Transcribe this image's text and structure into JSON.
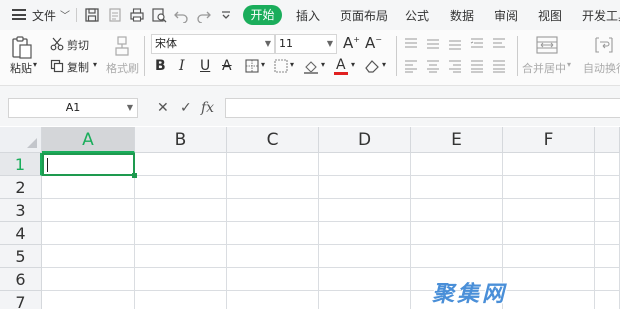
{
  "menubar": {
    "file_label": "文件",
    "tabs": [
      "开始",
      "插入",
      "页面布局",
      "公式",
      "数据",
      "审阅",
      "视图",
      "开发工具"
    ],
    "active_tab": "开始"
  },
  "ribbon": {
    "paste_label": "粘贴",
    "cut_label": "剪切",
    "copy_label": "复制",
    "format_painter_label": "格式刷",
    "font_name": "宋体",
    "font_size": "11",
    "merge_center_label": "合并居中",
    "wrap_text_label": "自动换行",
    "font_color": "#e02020",
    "accent": "#1aad5b"
  },
  "formula_bar": {
    "cell_ref": "A1",
    "cancel_symbol": "✕",
    "confirm_symbol": "✓",
    "fx_symbol": "fx",
    "value": ""
  },
  "grid": {
    "columns": [
      "A",
      "B",
      "C",
      "D",
      "E",
      "F"
    ],
    "rows": [
      "1",
      "2",
      "3",
      "4",
      "5",
      "6",
      "7"
    ],
    "active_cell": "A1"
  },
  "watermark": "聚集网"
}
